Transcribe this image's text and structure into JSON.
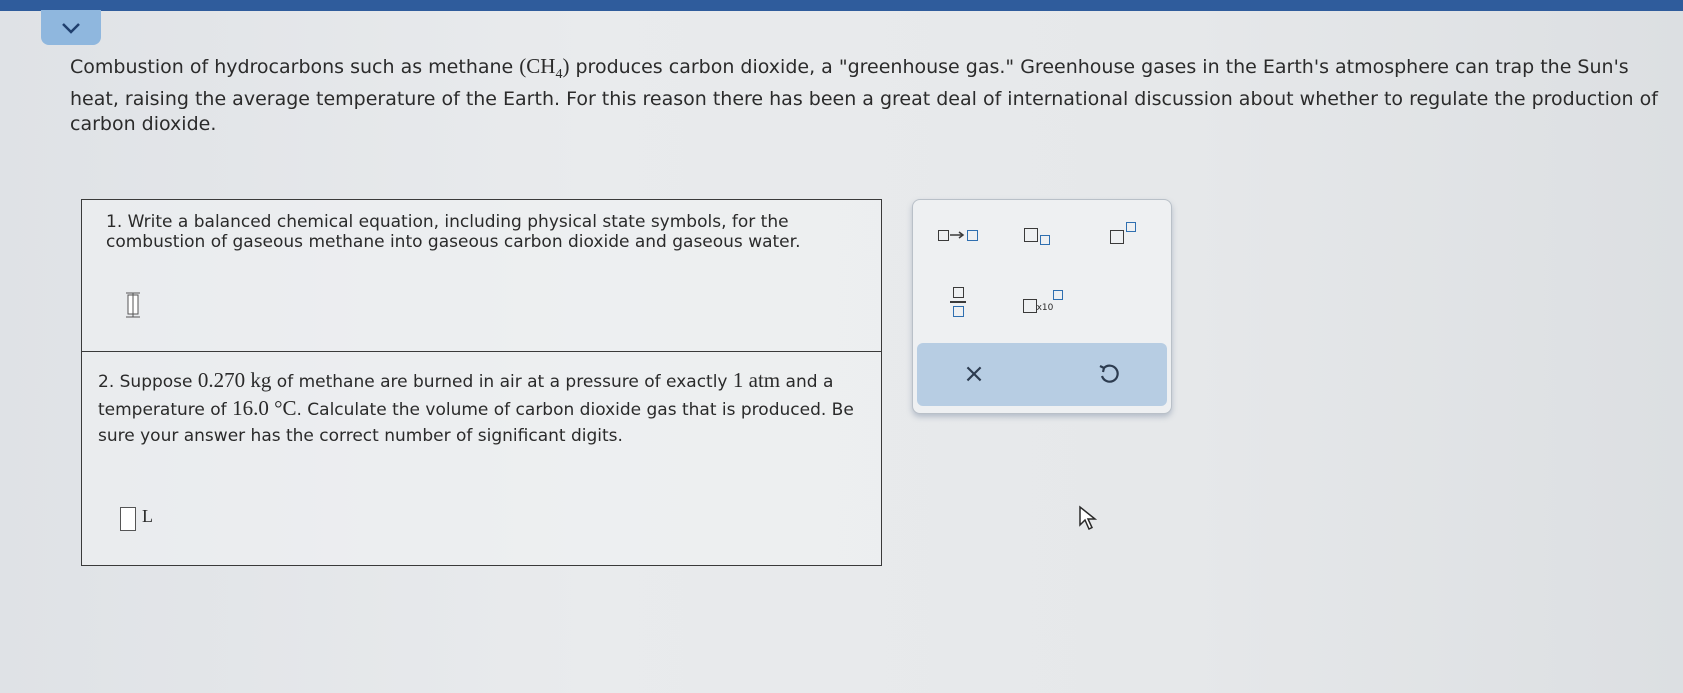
{
  "collapse": {
    "icon": "chevron-down-icon"
  },
  "intro": {
    "part1": "Combustion of hydrocarbons such as methane ",
    "formula_ch": "(CH",
    "formula_sub": "4",
    "formula_close": ")",
    "part2": " produces carbon dioxide, a \"greenhouse gas.\" Greenhouse gases in the Earth's atmosphere can trap the Sun's heat, raising the average temperature of the Earth. For this reason there has been a great deal of international discussion about whether to regulate the production of carbon dioxide."
  },
  "question1": {
    "text": "1. Write a balanced chemical equation, including physical state symbols, for the combustion of gaseous methane into gaseous carbon dioxide and gaseous water."
  },
  "question2": {
    "t1": "2. Suppose ",
    "mass": "0.270 kg",
    "t2": " of methane are burned in air at a pressure of exactly ",
    "pressure": "1 atm",
    "t3": " and a temperature of ",
    "temp": "16.0 °C",
    "t4": ". Calculate the volume of carbon dioxide gas that is produced. Be sure your answer has the correct number of significant digits.",
    "unit": "L"
  },
  "palette": {
    "x10_label": "x10",
    "clear_symbol": "×",
    "undo_icon": "undo-icon",
    "arrow_icon": "reaction-arrow-icon",
    "subscript_icon": "subscript-icon",
    "superscript_icon": "superscript-icon",
    "fraction_icon": "fraction-icon",
    "scientific_icon": "scientific-notation-icon"
  },
  "colors": {
    "top_bar": "#2f5c9c",
    "collapse_button": "#8fb7de",
    "action_bar": "#b7cde3"
  }
}
